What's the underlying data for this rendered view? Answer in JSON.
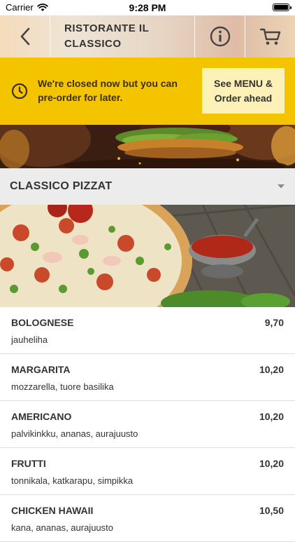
{
  "status_bar": {
    "carrier": "Carrier",
    "time": "9:28 PM"
  },
  "nav": {
    "title": "RISTORANTE IL CLASSICO",
    "icons": [
      "chevron-left-icon",
      "info-icon",
      "cart-icon"
    ]
  },
  "closed_banner": {
    "message": "We're closed now but you can pre-order for later.",
    "button_label": "See MENU & Order ahead",
    "color": "#f5c400"
  },
  "section": {
    "title": "CLASSICO PIZZAT"
  },
  "menu_items": [
    {
      "name": "BOLOGNESE",
      "price": "9,70",
      "description": "jauheliha"
    },
    {
      "name": "MARGARITA",
      "price": "10,20",
      "description": "mozzarella, tuore basilika"
    },
    {
      "name": "AMERICANO",
      "price": "10,20",
      "description": "palvikinkku, ananas, aurajuusto"
    },
    {
      "name": "FRUTTI",
      "price": "10,20",
      "description": "tonnikala, katkarapu, simpikka"
    },
    {
      "name": "CHICKEN HAWAII",
      "price": "10,50",
      "description": "kana, ananas, aurajuusto"
    }
  ]
}
